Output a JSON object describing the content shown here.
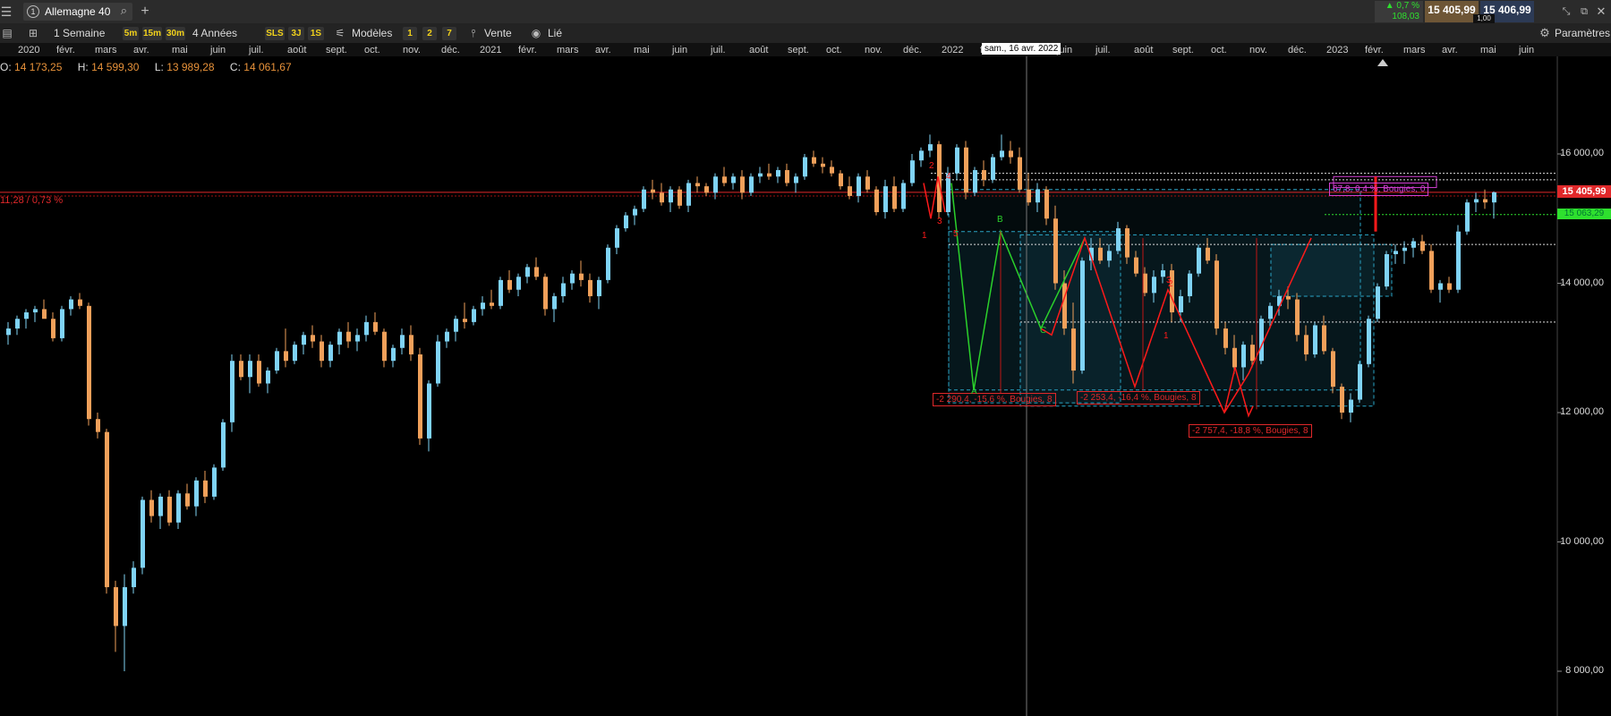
{
  "header": {
    "menu_icon": "hamburger-icon",
    "instrument_number": "1",
    "instrument_name": "Allemagne 40",
    "search_icon": "search-icon",
    "add_tab": "+",
    "change_pct": "▲ 0,7 %",
    "change_abs": "108,03",
    "sell_price": "15 405,99",
    "buy_price": "15 406,99",
    "spread": "1,00"
  },
  "toolbar": {
    "period": "1 Semaine",
    "tf_buttons": [
      "5m",
      "15m",
      "30m"
    ],
    "range": "4 Années",
    "tf_buttons2": [
      "SLS",
      "3J",
      "1S"
    ],
    "models": "Modèles",
    "num_buttons": [
      "1",
      "2",
      "7"
    ],
    "sell": "Vente",
    "linked": "Lié",
    "settings": "Paramètres"
  },
  "time_axis": {
    "labels": [
      "2020",
      "févr.",
      "mars",
      "avr.",
      "mai",
      "juin",
      "juil.",
      "août",
      "sept.",
      "oct.",
      "nov.",
      "déc.",
      "2021",
      "févr.",
      "mars",
      "avr.",
      "mai",
      "juin",
      "juil.",
      "août",
      "sept.",
      "oct.",
      "nov.",
      "déc.",
      "2022",
      "févr.",
      "m",
      "juin",
      "juil.",
      "août",
      "sept.",
      "oct.",
      "nov.",
      "déc.",
      "2023",
      "févr.",
      "mars",
      "avr.",
      "mai",
      "juin"
    ],
    "cursor_label": "sam., 16 avr. 2022"
  },
  "ohlc": {
    "o_label": "O:",
    "o": "14 173,25",
    "h_label": "H:",
    "h": "14 599,30",
    "l_label": "L:",
    "l": "13 989,28",
    "c_label": "C:",
    "c": "14 061,67"
  },
  "price_axis": {
    "ticks": [
      "16 000,00",
      "14 000,00",
      "12 000,00",
      "10 000,00",
      "8 000,00"
    ],
    "current": "15 405,99",
    "green_level": "15 063,29",
    "left_marker": "11,28 / 0,73 %"
  },
  "annotations": {
    "box1": "-2 290,4, -15,6 %, Bougies, 8",
    "box2": "-2 253,4, -16,4 %, Bougies, 8",
    "box3": "-2 757,4, -18,8 %, Bougies, 8",
    "box4": "67,8, 0,4 %, Bougies, 0",
    "wave_labels_green": [
      "A",
      "B",
      "C"
    ],
    "wave_labels_red": [
      "1",
      "2",
      "3",
      "4",
      "5",
      "1",
      "2",
      "3"
    ]
  },
  "chart_data": {
    "type": "candlestick",
    "title": "",
    "ylim": [
      7700,
      17500
    ],
    "y_ticks": [
      8000,
      10000,
      12000,
      14000,
      16000
    ],
    "current_price": 15405.99,
    "colors": {
      "up": "#7fd3f5",
      "down": "#f0a05a",
      "wave_green": "#2bd12b",
      "wave_red": "#ff1a1a",
      "box": "#2aa6c8"
    },
    "candles": [
      [
        13200,
        13400,
        13050,
        13300
      ],
      [
        13300,
        13500,
        13200,
        13450
      ],
      [
        13450,
        13600,
        13300,
        13550
      ],
      [
        13550,
        13650,
        13400,
        13600
      ],
      [
        13600,
        13750,
        13500,
        13450
      ],
      [
        13450,
        13550,
        13100,
        13150
      ],
      [
        13150,
        13650,
        13100,
        13600
      ],
      [
        13600,
        13800,
        13500,
        13750
      ],
      [
        13750,
        13850,
        13600,
        13650
      ],
      [
        13650,
        13700,
        11800,
        11900
      ],
      [
        11900,
        12000,
        11600,
        11700
      ],
      [
        11700,
        11750,
        9200,
        9300
      ],
      [
        9300,
        9400,
        8300,
        8700
      ],
      [
        8700,
        9500,
        8000,
        9300
      ],
      [
        9300,
        9700,
        9200,
        9600
      ],
      [
        9600,
        10700,
        9500,
        10650
      ],
      [
        10650,
        10800,
        10300,
        10400
      ],
      [
        10400,
        10750,
        10200,
        10700
      ],
      [
        10700,
        10800,
        10250,
        10300
      ],
      [
        10300,
        10800,
        10200,
        10750
      ],
      [
        10750,
        10900,
        10500,
        10550
      ],
      [
        10550,
        11000,
        10400,
        10950
      ],
      [
        10950,
        11100,
        10600,
        10700
      ],
      [
        10700,
        11200,
        10650,
        11150
      ],
      [
        11150,
        11900,
        11100,
        11850
      ],
      [
        11850,
        12900,
        11700,
        12800
      ],
      [
        12800,
        12900,
        12500,
        12550
      ],
      [
        12550,
        12900,
        12300,
        12800
      ],
      [
        12800,
        12900,
        12400,
        12450
      ],
      [
        12450,
        12700,
        12300,
        12650
      ],
      [
        12650,
        13000,
        12600,
        12950
      ],
      [
        12950,
        13300,
        12700,
        12800
      ],
      [
        12800,
        13100,
        12750,
        13050
      ],
      [
        13050,
        13250,
        12900,
        13200
      ],
      [
        13200,
        13350,
        13000,
        13100
      ],
      [
        13100,
        13200,
        12700,
        12800
      ],
      [
        12800,
        13100,
        12700,
        13050
      ],
      [
        13050,
        13300,
        12900,
        13250
      ],
      [
        13250,
        13400,
        13000,
        13100
      ],
      [
        13100,
        13300,
        12950,
        13200
      ],
      [
        13200,
        13500,
        13100,
        13400
      ],
      [
        13400,
        13550,
        13200,
        13250
      ],
      [
        13250,
        13300,
        12700,
        12800
      ],
      [
        12800,
        13050,
        12700,
        13000
      ],
      [
        13000,
        13300,
        12900,
        13200
      ],
      [
        13200,
        13350,
        12800,
        12900
      ],
      [
        12900,
        13000,
        11500,
        11600
      ],
      [
        11600,
        12500,
        11400,
        12450
      ],
      [
        12450,
        13200,
        12400,
        13100
      ],
      [
        13100,
        13300,
        13000,
        13250
      ],
      [
        13250,
        13500,
        13100,
        13450
      ],
      [
        13450,
        13700,
        13300,
        13400
      ],
      [
        13400,
        13650,
        13350,
        13600
      ],
      [
        13600,
        13800,
        13500,
        13700
      ],
      [
        13700,
        13900,
        13600,
        13650
      ],
      [
        13650,
        14100,
        13600,
        14050
      ],
      [
        14050,
        14200,
        13850,
        13900
      ],
      [
        13900,
        14150,
        13800,
        14100
      ],
      [
        14100,
        14300,
        14000,
        14250
      ],
      [
        14250,
        14400,
        14050,
        14100
      ],
      [
        14100,
        14150,
        13500,
        13600
      ],
      [
        13600,
        13850,
        13400,
        13800
      ],
      [
        13800,
        14100,
        13700,
        14000
      ],
      [
        14000,
        14200,
        13900,
        14150
      ],
      [
        14150,
        14350,
        13950,
        14050
      ],
      [
        14050,
        14150,
        13700,
        13800
      ],
      [
        13800,
        14100,
        13600,
        14050
      ],
      [
        14050,
        14600,
        14000,
        14550
      ],
      [
        14550,
        14900,
        14450,
        14850
      ],
      [
        14850,
        15100,
        14800,
        15050
      ],
      [
        15050,
        15200,
        14900,
        15150
      ],
      [
        15150,
        15500,
        15100,
        15450
      ],
      [
        15450,
        15600,
        15300,
        15400
      ],
      [
        15400,
        15550,
        15200,
        15250
      ],
      [
        15250,
        15500,
        15100,
        15450
      ],
      [
        15450,
        15500,
        15150,
        15200
      ],
      [
        15200,
        15600,
        15100,
        15550
      ],
      [
        15550,
        15650,
        15400,
        15500
      ],
      [
        15500,
        15550,
        15350,
        15400
      ],
      [
        15400,
        15700,
        15300,
        15650
      ],
      [
        15650,
        15800,
        15500,
        15550
      ],
      [
        15550,
        15700,
        15450,
        15650
      ],
      [
        15650,
        15750,
        15300,
        15400
      ],
      [
        15400,
        15700,
        15350,
        15650
      ],
      [
        15650,
        15800,
        15550,
        15700
      ],
      [
        15700,
        15850,
        15600,
        15650
      ],
      [
        15650,
        15800,
        15550,
        15750
      ],
      [
        15750,
        15850,
        15500,
        15550
      ],
      [
        15550,
        15700,
        15400,
        15650
      ],
      [
        15650,
        16000,
        15600,
        15950
      ],
      [
        15950,
        16050,
        15800,
        15850
      ],
      [
        15850,
        15950,
        15700,
        15800
      ],
      [
        15800,
        15900,
        15650,
        15700
      ],
      [
        15700,
        15750,
        15450,
        15500
      ],
      [
        15500,
        15650,
        15300,
        15350
      ],
      [
        15350,
        15700,
        15250,
        15650
      ],
      [
        15650,
        15750,
        15400,
        15450
      ],
      [
        15450,
        15500,
        15050,
        15100
      ],
      [
        15100,
        15600,
        15000,
        15500
      ],
      [
        15500,
        15650,
        15100,
        15150
      ],
      [
        15150,
        15600,
        15100,
        15550
      ],
      [
        15550,
        16000,
        15500,
        15900
      ],
      [
        15900,
        16100,
        15800,
        16050
      ],
      [
        16050,
        16300,
        15950,
        16150
      ],
      [
        16150,
        16200,
        15000,
        15100
      ],
      [
        15100,
        15800,
        15050,
        15700
      ],
      [
        15700,
        16150,
        15600,
        16100
      ],
      [
        16100,
        16200,
        15300,
        15400
      ],
      [
        15400,
        15800,
        15350,
        15750
      ],
      [
        15750,
        15900,
        15500,
        15600
      ],
      [
        15600,
        16000,
        15550,
        15950
      ],
      [
        15950,
        16300,
        15900,
        16050
      ],
      [
        16050,
        16200,
        15850,
        15950
      ],
      [
        15950,
        16100,
        15400,
        15450
      ],
      [
        15450,
        15700,
        15200,
        15250
      ],
      [
        15250,
        15550,
        15100,
        15450
      ],
      [
        15450,
        15500,
        14900,
        15000
      ],
      [
        15000,
        15200,
        13900,
        14000
      ],
      [
        14000,
        14200,
        13200,
        13300
      ],
      [
        13300,
        13700,
        12450,
        12650
      ],
      [
        12650,
        14400,
        12600,
        14350
      ],
      [
        14350,
        14700,
        14200,
        14550
      ],
      [
        14550,
        14700,
        14300,
        14350
      ],
      [
        14350,
        14600,
        14250,
        14500
      ],
      [
        14500,
        14950,
        14450,
        14850
      ],
      [
        14850,
        14900,
        14300,
        14400
      ],
      [
        14400,
        14500,
        14100,
        14150
      ],
      [
        14150,
        14250,
        13800,
        13850
      ],
      [
        13850,
        14200,
        13700,
        14100
      ],
      [
        14100,
        14300,
        14000,
        14200
      ],
      [
        14200,
        14300,
        13400,
        13550
      ],
      [
        13550,
        13900,
        13400,
        13800
      ],
      [
        13800,
        14200,
        13700,
        14150
      ],
      [
        14150,
        14600,
        14100,
        14550
      ],
      [
        14550,
        14700,
        14300,
        14350
      ],
      [
        14350,
        14450,
        13200,
        13300
      ],
      [
        13300,
        13400,
        12900,
        13000
      ],
      [
        13000,
        13200,
        12600,
        12700
      ],
      [
        12700,
        13100,
        12500,
        13050
      ],
      [
        13050,
        13200,
        12700,
        12800
      ],
      [
        12800,
        13500,
        12750,
        13450
      ],
      [
        13450,
        13700,
        13300,
        13650
      ],
      [
        13650,
        13900,
        13500,
        13800
      ],
      [
        13800,
        13950,
        13600,
        13750
      ],
      [
        13750,
        13850,
        13100,
        13200
      ],
      [
        13200,
        13350,
        12800,
        12900
      ],
      [
        12900,
        13400,
        12850,
        13350
      ],
      [
        13350,
        13500,
        12900,
        12950
      ],
      [
        12950,
        13000,
        12300,
        12400
      ],
      [
        12400,
        12450,
        11900,
        12000
      ],
      [
        12000,
        12300,
        11850,
        12200
      ],
      [
        12200,
        12800,
        12150,
        12750
      ],
      [
        12750,
        13500,
        12700,
        13450
      ],
      [
        13450,
        14000,
        13400,
        13950
      ],
      [
        13950,
        14500,
        13900,
        14450
      ],
      [
        14450,
        14600,
        14300,
        14500
      ],
      [
        14500,
        14650,
        14300,
        14550
      ],
      [
        14550,
        14700,
        14400,
        14650
      ],
      [
        14650,
        14750,
        14450,
        14500
      ],
      [
        14500,
        14600,
        13850,
        13900
      ],
      [
        13900,
        14050,
        13700,
        14000
      ],
      [
        14000,
        14100,
        13850,
        13900
      ],
      [
        13900,
        14900,
        13850,
        14800
      ],
      [
        14800,
        15300,
        14750,
        15250
      ],
      [
        15250,
        15400,
        15100,
        15300
      ],
      [
        15300,
        15450,
        15150,
        15250
      ],
      [
        15250,
        15420,
        15000,
        15405.99
      ]
    ]
  }
}
